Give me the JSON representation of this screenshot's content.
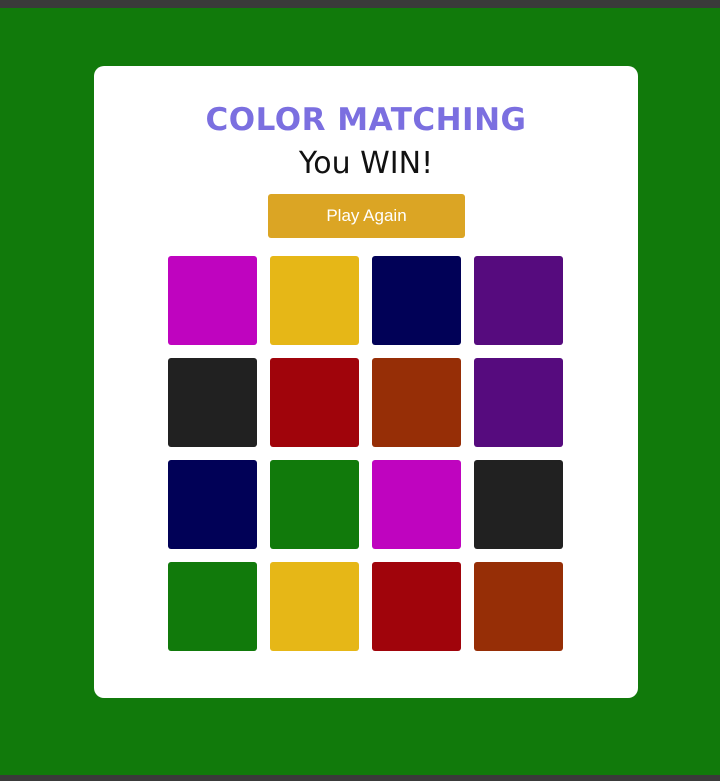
{
  "game": {
    "title": "COLOR MATCHING",
    "status": "You WIN!",
    "play_again_label": "Play Again"
  },
  "colors": {
    "background": "#117a0b",
    "title": "#7b6fe0",
    "button": "#dba524"
  },
  "tiles": [
    {
      "color": "#bf04bf"
    },
    {
      "color": "#e6b717"
    },
    {
      "color": "#010157"
    },
    {
      "color": "#560b7e"
    },
    {
      "color": "#212121"
    },
    {
      "color": "#a0040b"
    },
    {
      "color": "#962e06"
    },
    {
      "color": "#560b7e"
    },
    {
      "color": "#010157"
    },
    {
      "color": "#117a0b"
    },
    {
      "color": "#bf04bf"
    },
    {
      "color": "#212121"
    },
    {
      "color": "#117a0b"
    },
    {
      "color": "#e6b717"
    },
    {
      "color": "#a0040b"
    },
    {
      "color": "#962e06"
    }
  ]
}
